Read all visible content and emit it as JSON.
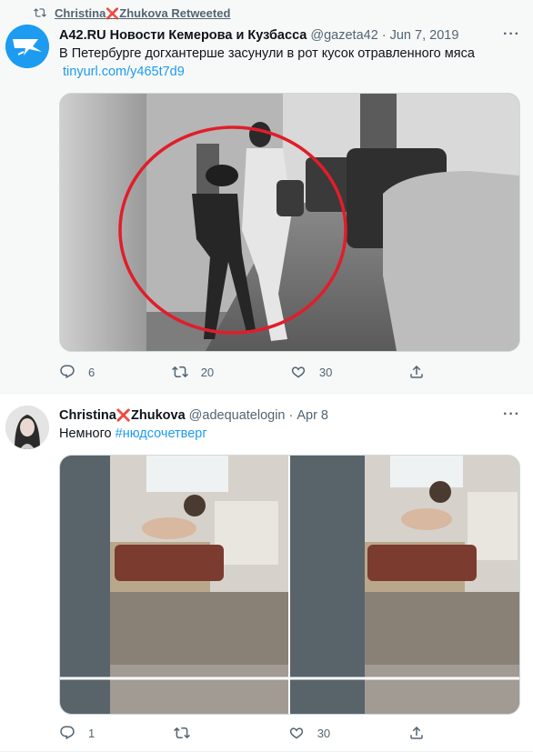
{
  "retweet_bar": {
    "icon": "retweet-icon",
    "name_part1": "Christina",
    "cross": "❌",
    "name_part2": "Zhukova",
    "suffix": " Retweeted"
  },
  "tweets": [
    {
      "avatar_icon": "a42-logo",
      "name": "A42.RU Новости Кемерова и Кузбасса",
      "handle": "@gazeta42",
      "dot": "·",
      "date": "Jun 7, 2019",
      "text": "В Петербурге догхантерше засунули в рот кусок отравленного мяса",
      "link": "tinyurl.com/y465t7d9",
      "more": "···",
      "replies": "6",
      "retweets": "20",
      "likes": "30"
    },
    {
      "avatar_icon": "user-photo",
      "name_part1": "Christina",
      "cross": "❌",
      "name_part2": "Zhukova",
      "handle": "@adequatelogin",
      "dot": "·",
      "date": "Apr 8",
      "text_plain": "Немного ",
      "hashtag": "#нюдсочетверг",
      "more": "···",
      "replies": "1",
      "retweets": "",
      "likes": "30"
    }
  ],
  "colors": {
    "link": "#1d9bf0",
    "muted": "#536471",
    "cross": "#e0245e"
  }
}
